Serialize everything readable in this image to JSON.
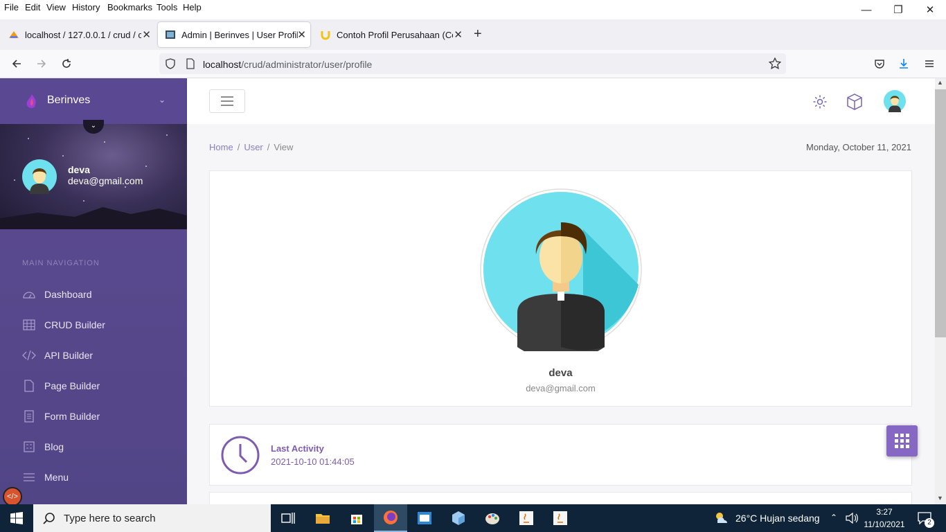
{
  "menu": {
    "items": [
      "File",
      "Edit",
      "View",
      "History",
      "Bookmarks",
      "Tools",
      "Help"
    ]
  },
  "tabs": [
    {
      "title": "localhost / 127.0.0.1 / crud / cc_"
    },
    {
      "title": "Admin | Berinves | User Profile"
    },
    {
      "title": "Contoh Profil Perusahaan (Com"
    }
  ],
  "url": {
    "host": "localhost",
    "path": "/crud/administrator/user/profile"
  },
  "sidebar": {
    "brand": "Berinves",
    "user": {
      "name": "deva",
      "email": "deva@gmail.com"
    },
    "section": "MAIN NAVIGATION",
    "items": [
      {
        "label": "Dashboard",
        "icon": "dashboard-icon"
      },
      {
        "label": "CRUD Builder",
        "icon": "table-icon"
      },
      {
        "label": "API Builder",
        "icon": "code-icon"
      },
      {
        "label": "Page Builder",
        "icon": "file-icon"
      },
      {
        "label": "Form Builder",
        "icon": "form-icon"
      },
      {
        "label": "Blog",
        "icon": "blog-icon"
      },
      {
        "label": "Menu",
        "icon": "menu-icon"
      }
    ]
  },
  "breadcrumb": {
    "home": "Home",
    "user": "User",
    "view": "View",
    "sep": "/"
  },
  "date": "Monday, October 11, 2021",
  "profile": {
    "name": "deva",
    "email": "deva@gmail.com"
  },
  "activity": {
    "label": "Last Activity",
    "value": "2021-10-10 01:44:05"
  },
  "taskbar": {
    "search_placeholder": "Type here to search",
    "weather": "26°C  Hujan sedang",
    "time": "3:27",
    "date": "11/10/2021",
    "notif_count": "2"
  },
  "colors": {
    "sidebar": "#574590",
    "accent": "#8667c4",
    "link": "#8a7dc2"
  }
}
